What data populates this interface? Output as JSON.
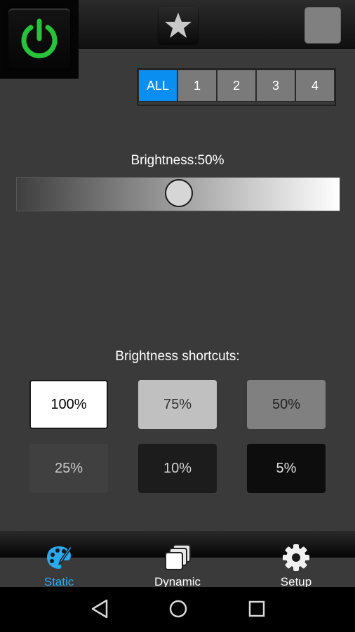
{
  "top_bar": {
    "power_icon": "power-icon",
    "favorite_icon": "star-icon",
    "current_color": "#808080"
  },
  "groups": {
    "items": [
      "ALL",
      "1",
      "2",
      "3",
      "4"
    ],
    "selected": "ALL"
  },
  "brightness": {
    "label": "Brightness:50%",
    "value_percent": 50
  },
  "shortcuts": {
    "label": "Brightness shortcuts:",
    "items": [
      {
        "label": "100%",
        "bg": "#ffffff",
        "fg": "#000000"
      },
      {
        "label": "75%",
        "bg": "#c0c0c0",
        "fg": "#333333"
      },
      {
        "label": "50%",
        "bg": "#808080",
        "fg": "#222222"
      },
      {
        "label": "25%",
        "bg": "#404040",
        "fg": "#c8c8c8"
      },
      {
        "label": "10%",
        "bg": "#1c1c1c",
        "fg": "#d0d0d0"
      },
      {
        "label": "5%",
        "bg": "#0d0d0d",
        "fg": "#e0e0e0"
      }
    ]
  },
  "bottom_nav": {
    "items": [
      {
        "label": "Static",
        "icon": "palette-icon",
        "active": true
      },
      {
        "label": "Dynamic",
        "icon": "layers-icon",
        "active": false
      },
      {
        "label": "Setup",
        "icon": "gear-icon",
        "active": false
      }
    ],
    "active_color": "#2aa8f0"
  },
  "system_nav": [
    "back-icon",
    "home-icon",
    "recents-icon"
  ]
}
